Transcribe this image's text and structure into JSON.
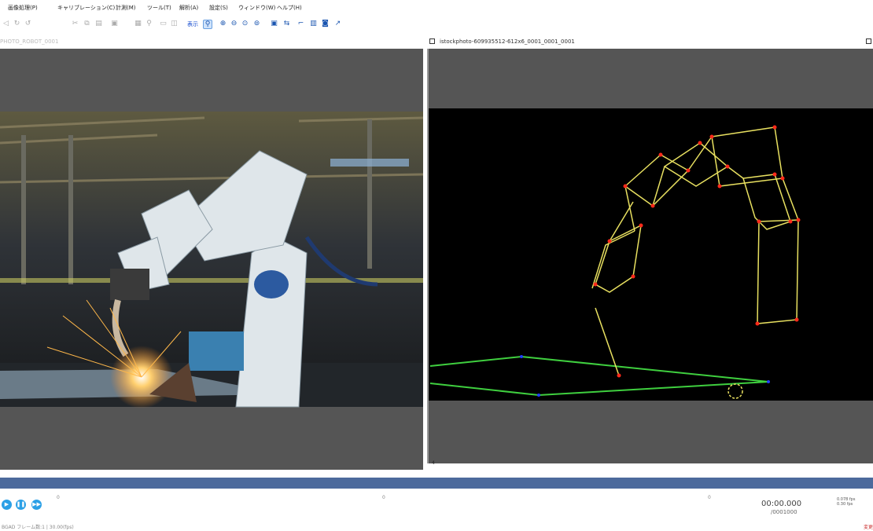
{
  "menu": [
    "画像処理(P)",
    "キャリブレーション(C)",
    "計測(M)",
    "ツール(T)",
    "解析(A)",
    "設定(S)",
    "ウィンドウ(W)",
    "ヘルプ(H)"
  ],
  "toolbar": {
    "mode_label": "表示"
  },
  "left_pane": {
    "title": "PHOTO_ROBOT_0001"
  },
  "right_pane": {
    "title": "istockphoto-609935512-612x6_0001_0001_0001",
    "scroll_label": "4"
  },
  "playback": {
    "timecode": "00:00.000",
    "frame": "/0001000",
    "speed": "0.078 fps\n0.30 fps",
    "status": "BGAD フレーム数:1 | 30.00(fps)",
    "status_right": "変更",
    "ticks": [
      "0",
      "0",
      "0"
    ]
  },
  "colors": {
    "pane_bg": "#555555",
    "skeleton": "#e8e060",
    "joint": "#ff2a1a",
    "ground": "#3fcf3f",
    "ground_point": "#2040ff",
    "timebar": "#4c6a9c"
  },
  "icons": [
    "open-icon",
    "save-icon",
    "undo-icon",
    "zoom-icon",
    "zoom-in-icon",
    "zoom-out-icon",
    "grid-icon",
    "play-icon",
    "pause-icon",
    "next-icon"
  ]
}
